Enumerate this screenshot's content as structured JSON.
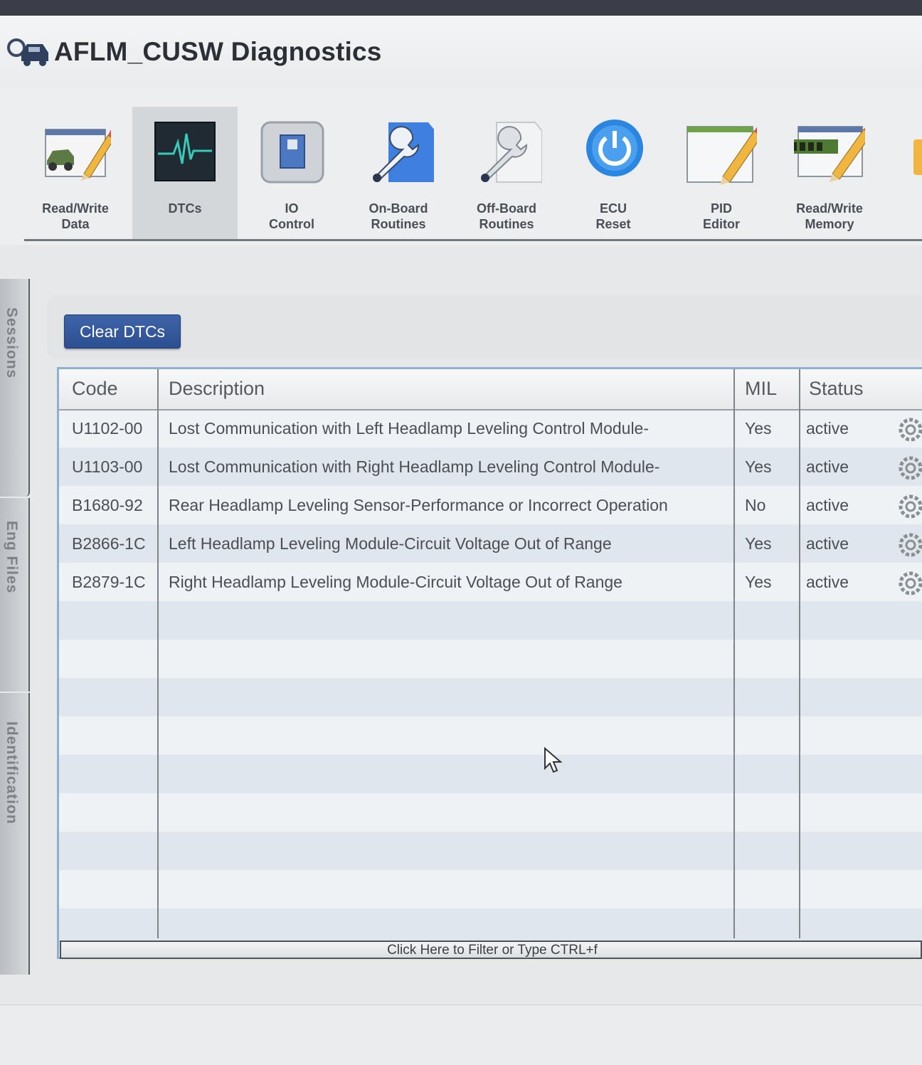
{
  "app": {
    "title": "AFLM_CUSW Diagnostics",
    "icon": "car-magnifier-icon"
  },
  "toolbar": {
    "items": [
      {
        "label": "Read/Write\nData",
        "icon": "car-pencil-icon"
      },
      {
        "label": "DTCs",
        "icon": "waveform-icon",
        "selected": true
      },
      {
        "label": "IO\nControl",
        "icon": "io-switch-icon"
      },
      {
        "label": "On-Board\nRoutines",
        "icon": "wrench-document-icon"
      },
      {
        "label": "Off-Board\nRoutines",
        "icon": "wrench-document-grey-icon"
      },
      {
        "label": "ECU\nReset",
        "icon": "power-icon"
      },
      {
        "label": "PID\nEditor",
        "icon": "pencil-document-icon"
      },
      {
        "label": "Read/Write\nMemory",
        "icon": "memory-pencil-icon"
      }
    ]
  },
  "sidebar": {
    "tabs": [
      "Sessions",
      "Eng Files",
      "Identification"
    ]
  },
  "actions": {
    "clear_dtcs": "Clear DTCs"
  },
  "table": {
    "columns": [
      "Code",
      "Description",
      "MIL",
      "Status"
    ],
    "rows": [
      {
        "code": "U1102-00",
        "description": "Lost Communication with Left Headlamp Leveling Control Module-",
        "mil": "Yes",
        "status": "active"
      },
      {
        "code": "U1103-00",
        "description": "Lost Communication with Right Headlamp Leveling Control Module-",
        "mil": "Yes",
        "status": "active"
      },
      {
        "code": "B1680-92",
        "description": "Rear Headlamp Leveling Sensor-Performance or Incorrect Operation",
        "mil": "No",
        "status": "active"
      },
      {
        "code": "B2866-1C",
        "description": "Left Headlamp Leveling Module-Circuit Voltage Out of Range",
        "mil": "Yes",
        "status": "active"
      },
      {
        "code": "B2879-1C",
        "description": "Right Headlamp Leveling Module-Circuit Voltage Out of Range",
        "mil": "Yes",
        "status": "active"
      }
    ]
  },
  "filter": {
    "hint": "Click Here to Filter or Type CTRL+f"
  },
  "colors": {
    "accent": "#2d4f91",
    "grid_border": "#8fb0cf",
    "stripe": "#dfe6ee"
  }
}
